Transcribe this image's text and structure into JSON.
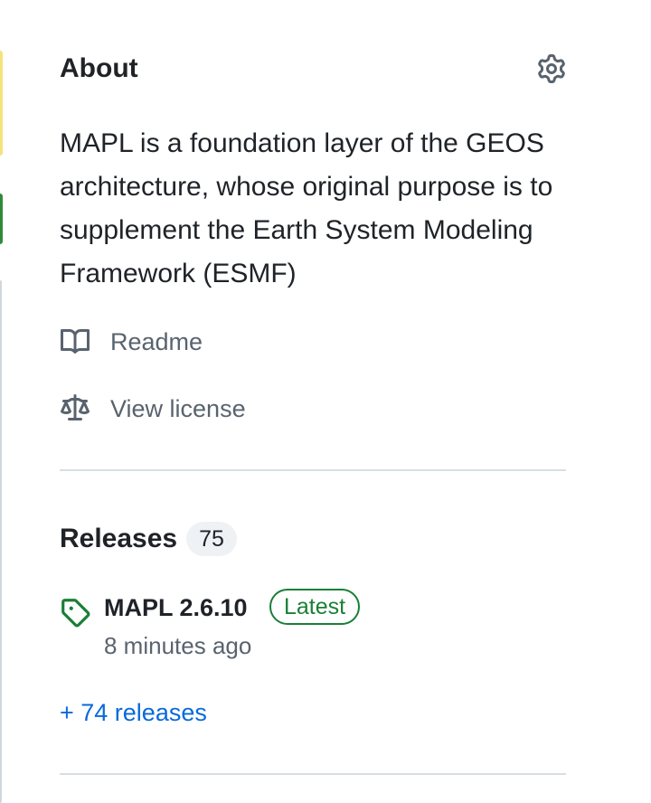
{
  "about": {
    "title": "About",
    "description": "MAPL is a foundation layer of the GEOS architecture, whose original purpose is to supplement the Earth System Modeling Framework (ESMF)",
    "readme_label": "Readme",
    "license_label": "View license"
  },
  "releases": {
    "title": "Releases",
    "count": "75",
    "latest": {
      "name": "MAPL 2.6.10",
      "badge": "Latest",
      "time": "8 minutes ago"
    },
    "more_label": "+ 74 releases"
  },
  "colors": {
    "link": "#0969da",
    "latest_badge": "#1a7f37",
    "muted_text": "#59636e"
  },
  "icons": {
    "settings": "gear-icon",
    "readme": "book-icon",
    "license": "law-scale-icon",
    "release": "tag-icon"
  }
}
